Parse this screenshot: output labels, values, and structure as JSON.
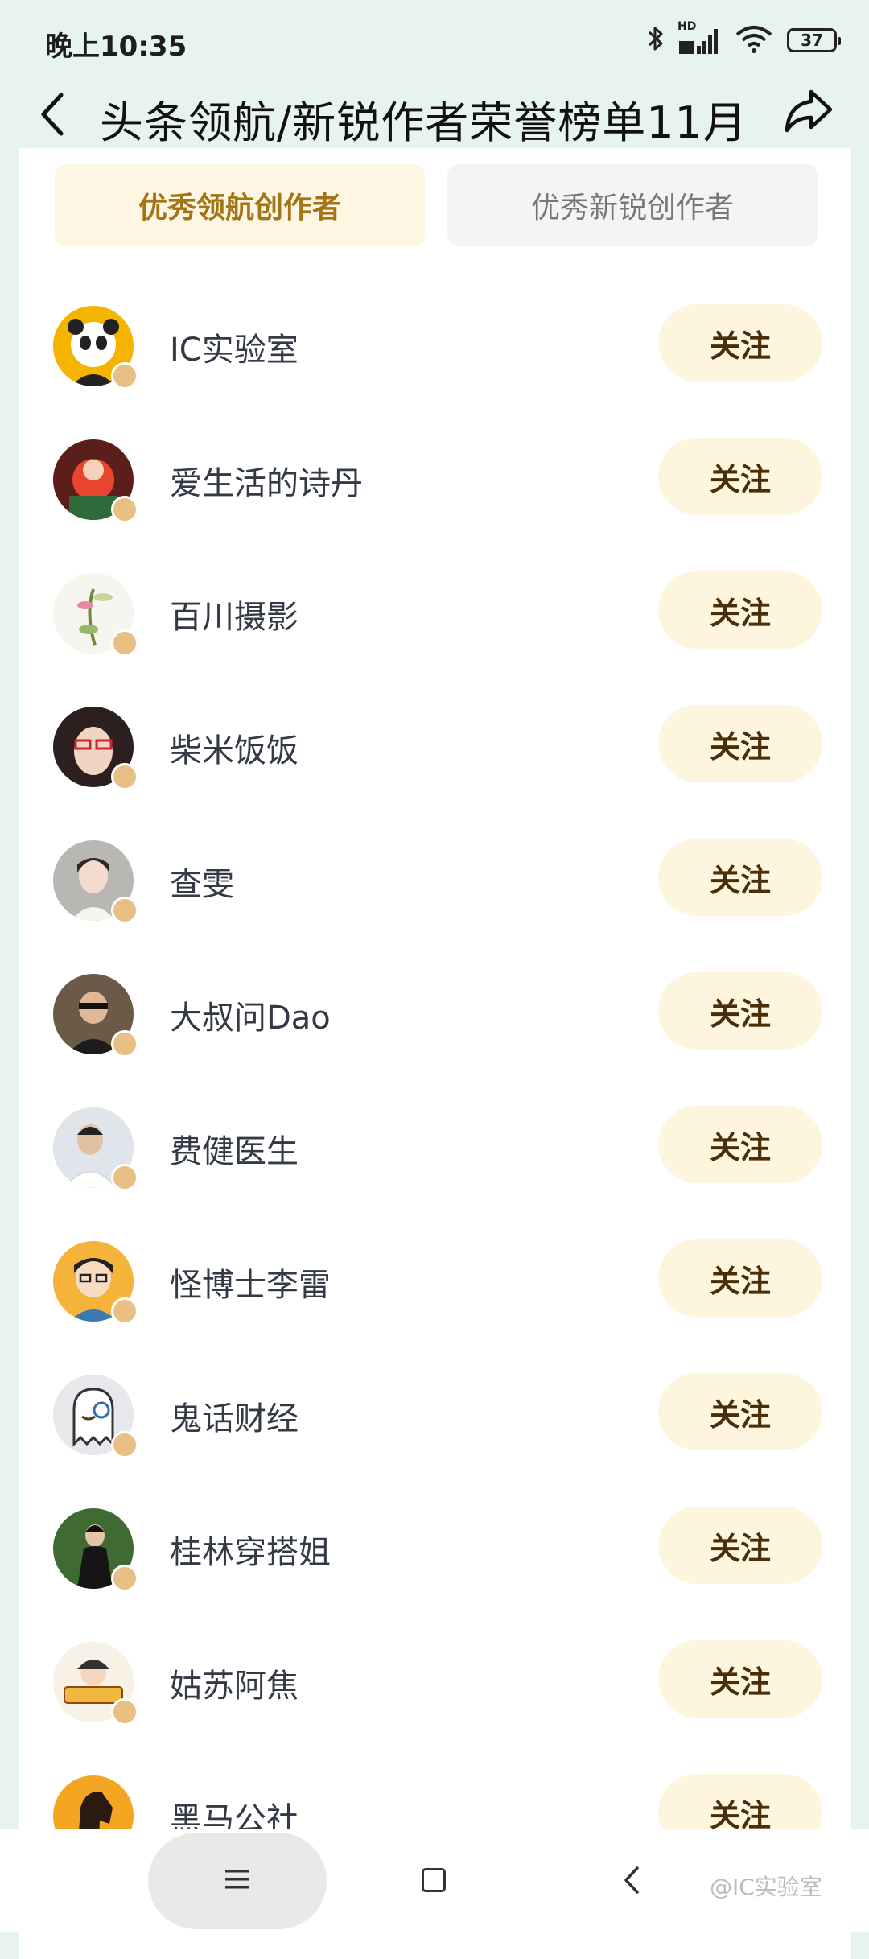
{
  "status_bar": {
    "time": "晚上10:35",
    "battery": "37",
    "network_label": "HD",
    "icons": [
      "bluetooth-icon",
      "signal-icon",
      "wifi-icon",
      "battery-icon"
    ]
  },
  "nav": {
    "title": "头条领航/新锐作者荣誉榜单11月",
    "back_icon": "chevron-left-icon",
    "share_icon": "share-icon"
  },
  "tabs": [
    {
      "label": "优秀领航创作者",
      "active": true
    },
    {
      "label": "优秀新锐创作者",
      "active": false
    }
  ],
  "creators": [
    {
      "name": "IC实验室",
      "follow_label": "关注",
      "avatar_color": "#f5b400"
    },
    {
      "name": "爱生活的诗丹",
      "follow_label": "关注",
      "avatar_color": "#8a2a22"
    },
    {
      "name": "百川摄影",
      "follow_label": "关注",
      "avatar_color": "#f3f1ec"
    },
    {
      "name": "柴米饭饭",
      "follow_label": "关注",
      "avatar_color": "#3b2a2a"
    },
    {
      "name": "查雯",
      "follow_label": "关注",
      "avatar_color": "#b9b7b3"
    },
    {
      "name": "大叔问Dao",
      "follow_label": "关注",
      "avatar_color": "#5a4a3c"
    },
    {
      "name": "费健医生",
      "follow_label": "关注",
      "avatar_color": "#dfe5ea"
    },
    {
      "name": "怪博士李雷",
      "follow_label": "关注",
      "avatar_color": "#f6b33a"
    },
    {
      "name": "鬼话财经",
      "follow_label": "关注",
      "avatar_color": "#e8e8ec"
    },
    {
      "name": "桂林穿搭姐",
      "follow_label": "关注",
      "avatar_color": "#2f4a2a"
    },
    {
      "name": "姑苏阿焦",
      "follow_label": "关注",
      "avatar_color": "#f4ede2"
    },
    {
      "name": "黑马公社",
      "follow_label": "关注",
      "avatar_color": "#f4a521"
    }
  ],
  "colors": {
    "page_bg": "#e6f3ef",
    "tab_active_bg": "#fdf6e2",
    "tab_active_text": "#a27517",
    "follow_bg": "#fdf5dd",
    "follow_text": "#4a2e08",
    "badge": "#e9bf84"
  },
  "system_nav": {
    "icons": [
      "menu-icon",
      "home-icon",
      "back-icon"
    ],
    "watermark": "@IC实验室"
  }
}
